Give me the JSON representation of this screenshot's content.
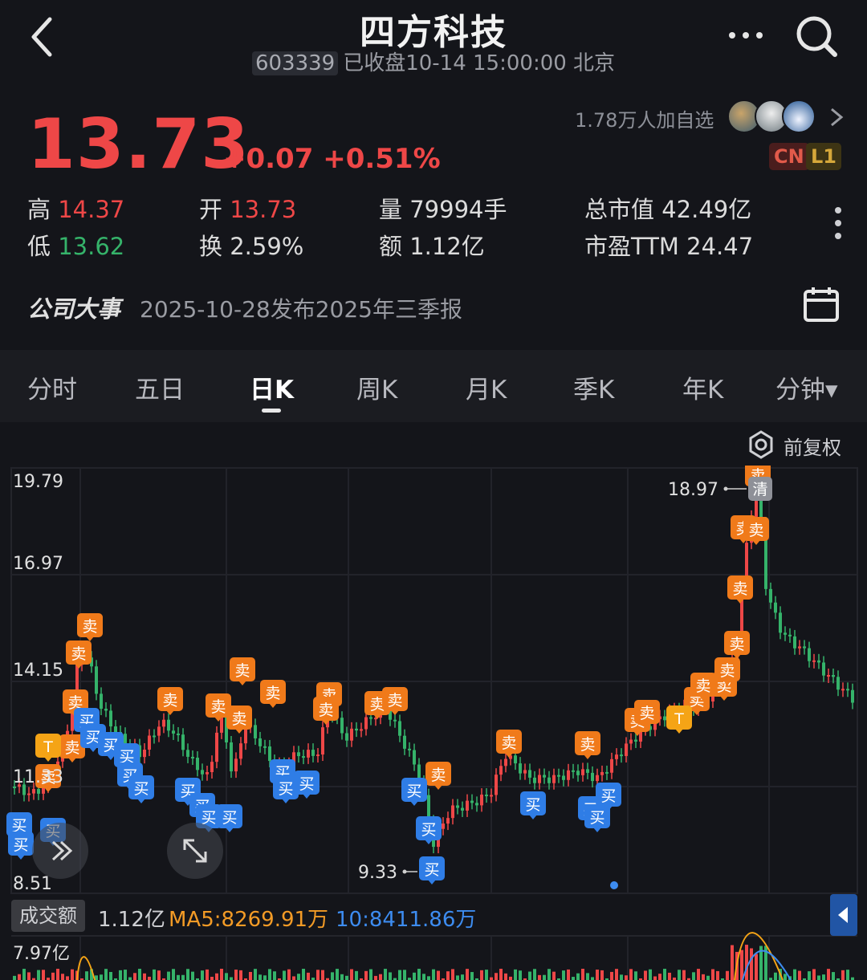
{
  "header": {
    "title": "四方科技",
    "code": "603339",
    "status": "已收盘10-14 15:00:00 北京"
  },
  "quote": {
    "price": "13.73",
    "change": "+0.07 +0.51%",
    "followers": "1.78万人加自选",
    "badge_cn": "CN",
    "badge_l1": "L1",
    "stats": {
      "high_label": "高",
      "high": "14.37",
      "open_label": "开",
      "open": "13.73",
      "volume": "量 79994手",
      "market_cap": "总市值 42.49亿",
      "low_label": "低",
      "low": "13.62",
      "turnover": "换 2.59%",
      "amount": "额 1.12亿",
      "pe": "市盈TTM 24.47"
    }
  },
  "events": {
    "label": "公司大事",
    "text": "2025-10-28发布2025年三季报"
  },
  "tabs": [
    "分时",
    "五日",
    "日K",
    "周K",
    "月K",
    "季K",
    "年K",
    "分钟▾"
  ],
  "chart": {
    "adjust_label": "前复权",
    "y_labels": [
      "19.79",
      "16.97",
      "14.15",
      "11.33",
      "8.51"
    ],
    "max_annot": "18.97",
    "min_annot": "9.33",
    "buy_label": "买",
    "sell_label": "卖",
    "t_label": "T",
    "clear_label": "清",
    "volume": {
      "label": "成交额",
      "value": "1.12亿",
      "ma5": "MA5:8269.91万",
      "ma10": "10:8411.86万",
      "max": "7.97亿"
    }
  },
  "colors": {
    "up": "#ee4747",
    "down": "#35b36a",
    "sell": "#f07a1a",
    "buy": "#2f7de6",
    "t": "#f5a416"
  }
}
